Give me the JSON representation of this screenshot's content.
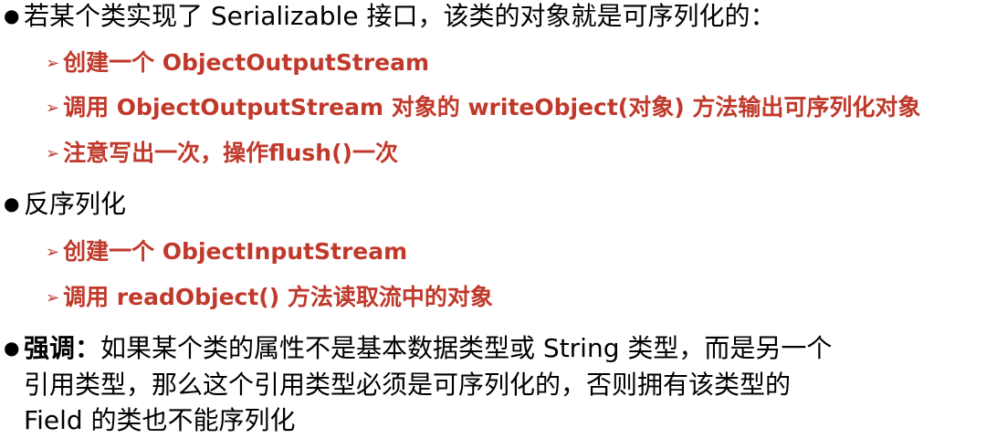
{
  "bullets": {
    "serialize": {
      "symbol": "●",
      "text": "若某个类实现了 Serializable 接口，该类的对象就是可序列化的：",
      "steps": [
        {
          "arrow": "➢",
          "text": "创建一个 ObjectOutputStream"
        },
        {
          "arrow": "➢",
          "text": "调用 ObjectOutputStream 对象的 writeObject(对象) 方法输出可序列化对象"
        },
        {
          "arrow": "➢",
          "text": "注意写出一次，操作flush()一次"
        }
      ]
    },
    "deserialize": {
      "symbol": "●",
      "text": "反序列化",
      "steps": [
        {
          "arrow": "➢",
          "text": "创建一个 ObjectInputStream"
        },
        {
          "arrow": "➢",
          "text": "调用 readObject() 方法读取流中的对象"
        }
      ]
    },
    "emphasis": {
      "symbol": "●",
      "label": "强调：",
      "lines": [
        "如果某个类的属性不是基本数据类型或 String  类型，而是另一个",
        "引用类型，那么这个引用类型必须是可序列化的，否则拥有该类型的",
        "Field 的类也不能序列化"
      ]
    }
  },
  "colors": {
    "step_text": "#c0392b",
    "body_text": "#000000",
    "background": "#ffffff"
  }
}
